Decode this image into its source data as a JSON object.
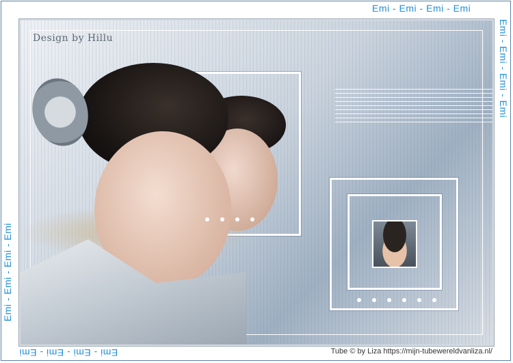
{
  "watermark": {
    "top": "Emi - Emi - Emi - Emi",
    "right": "Emi - Emi - Emi - Emi",
    "left": "Emi - Emi - Emi - Emi",
    "bottom": "Emi - Emi - Emi - Emi"
  },
  "signature": "Design by Hillu",
  "credit": "Tube © by Liza https://mijn-tubewereldvanliza.nl/",
  "colors": {
    "watermark": "#1f8fd6",
    "frame": "#5a7fa0"
  }
}
